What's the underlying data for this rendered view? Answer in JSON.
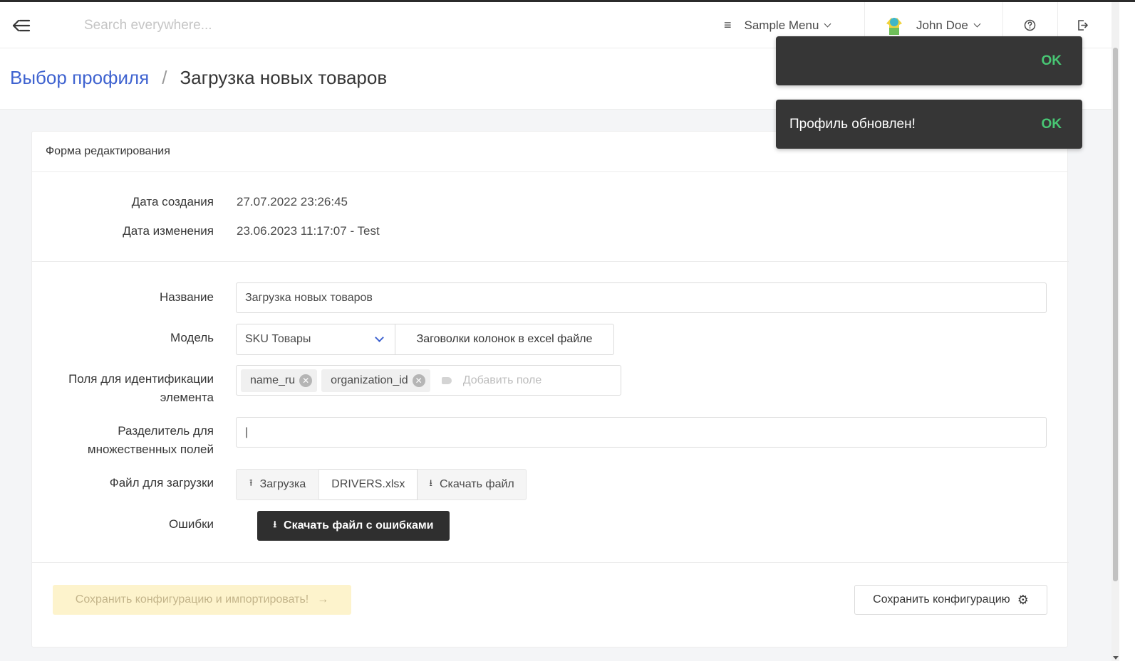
{
  "navbar": {
    "search_placeholder": "Search everywhere...",
    "menu_label": "Sample Menu",
    "user_name": "John Doe"
  },
  "breadcrumb": {
    "parent": "Выбор профиля",
    "separator": "/",
    "current": "Загрузка новых товаров"
  },
  "form": {
    "title": "Форма редактирования",
    "created_label": "Дата создания",
    "created_value": "27.07.2022 23:26:45",
    "modified_label": "Дата изменения",
    "modified_value": "23.06.2023 11:17:07 - Test",
    "name_label": "Название",
    "name_value": "Загрузка новых товаров",
    "model_label": "Модель",
    "model_value": "SKU Товары",
    "model_columns_button": "Заговолки колонок в excel файле",
    "id_fields_label_line1": "Поля для идентификации",
    "id_fields_label_line2": "элемента",
    "id_fields_tags": [
      "name_ru",
      "organization_id"
    ],
    "id_fields_placeholder": "Добавить поле",
    "separator_label_line1": "Разделитель для",
    "separator_label_line2": "множественных полей",
    "separator_value": "|",
    "file_label": "Файл для загрузки",
    "upload_button": "Загрузка",
    "file_name": "DRIVERS.xlsx",
    "download_button": "Скачать файл",
    "errors_label": "Ошибки",
    "errors_button": "Скачать файл с ошибками",
    "import_button": "Сохранить конфигурацию и импортировать!",
    "save_button": "Сохранить конфигурацию"
  },
  "toasts": [
    {
      "message": "",
      "action": "OK"
    },
    {
      "message": "Профиль обновлен!",
      "action": "OK"
    }
  ],
  "colors": {
    "link": "#3f63d0",
    "toast_bg": "#363636",
    "toast_ok": "#48c774",
    "import_bg": "#fdf3cc",
    "dark_button": "#2f2f2f"
  }
}
